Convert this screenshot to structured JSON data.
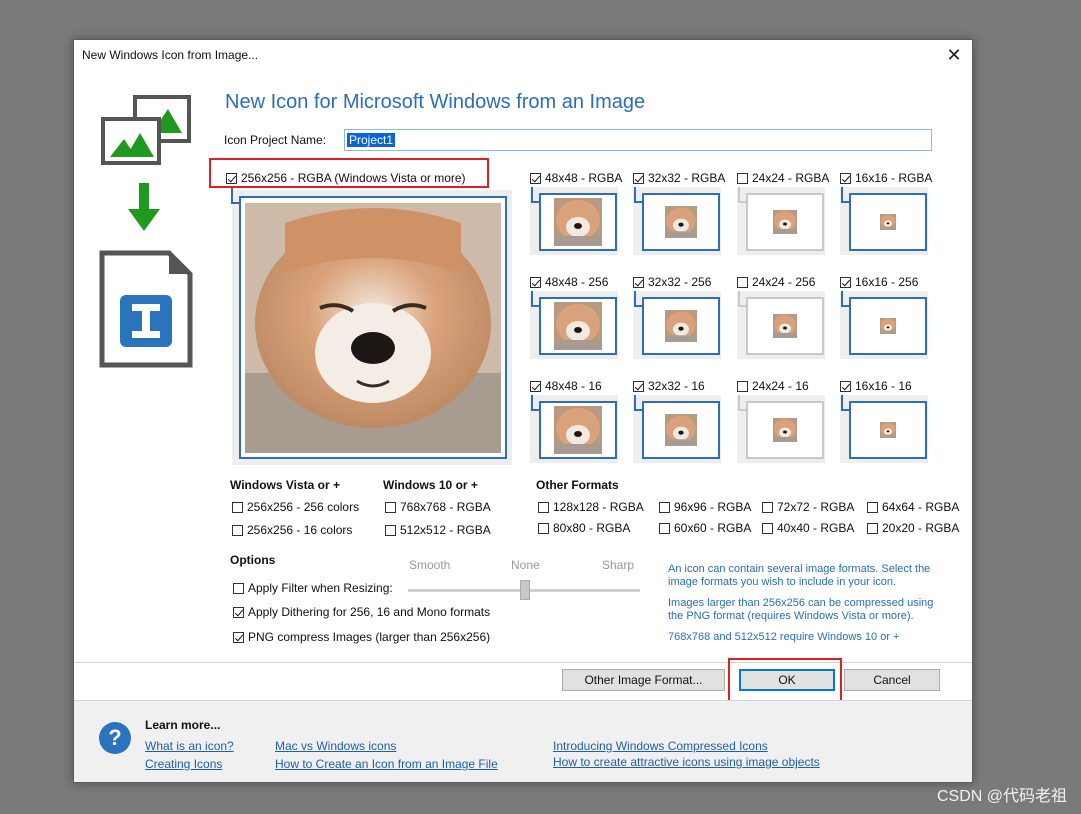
{
  "window": {
    "title": "New Windows Icon from Image...",
    "close_glyph": "✕"
  },
  "heading": "New Icon for Microsoft Windows from an Image",
  "project": {
    "label": "Icon Project Name:",
    "value": "Project1"
  },
  "main_format": {
    "label": "256x256 - RGBA (Windows Vista or more)",
    "checked": true
  },
  "formats": [
    {
      "label": "48x48 - RGBA",
      "checked": true
    },
    {
      "label": "32x32 - RGBA",
      "checked": true
    },
    {
      "label": "24x24 - RGBA",
      "checked": false
    },
    {
      "label": "16x16 - RGBA",
      "checked": true
    },
    {
      "label": "48x48 - 256",
      "checked": true
    },
    {
      "label": "32x32 - 256",
      "checked": true
    },
    {
      "label": "24x24 - 256",
      "checked": false
    },
    {
      "label": "16x16 - 256",
      "checked": true
    },
    {
      "label": "48x48 - 16",
      "checked": true
    },
    {
      "label": "32x32 - 16",
      "checked": true
    },
    {
      "label": "24x24 - 16",
      "checked": false
    },
    {
      "label": "16x16 - 16",
      "checked": true
    }
  ],
  "sections": {
    "vista": {
      "title": "Windows Vista or +",
      "items": [
        {
          "label": "256x256 - 256 colors",
          "checked": false
        },
        {
          "label": "256x256 - 16 colors",
          "checked": false
        }
      ]
    },
    "win10": {
      "title": "Windows 10 or +",
      "items": [
        {
          "label": "768x768 - RGBA",
          "checked": false
        },
        {
          "label": "512x512 - RGBA",
          "checked": false
        }
      ]
    },
    "other": {
      "title": "Other Formats",
      "items": [
        {
          "label": "128x128 - RGBA",
          "checked": false
        },
        {
          "label": "96x96 - RGBA",
          "checked": false
        },
        {
          "label": "72x72 - RGBA",
          "checked": false
        },
        {
          "label": "64x64 - RGBA",
          "checked": false
        },
        {
          "label": "80x80 - RGBA",
          "checked": false
        },
        {
          "label": "60x60 - RGBA",
          "checked": false
        },
        {
          "label": "40x40 - RGBA",
          "checked": false
        },
        {
          "label": "20x20 - RGBA",
          "checked": false
        }
      ]
    }
  },
  "options": {
    "title": "Options",
    "filter": {
      "label": "Apply Filter when Resizing:",
      "checked": false
    },
    "dithering": {
      "label": "Apply Dithering for 256, 16 and Mono formats",
      "checked": true
    },
    "png": {
      "label": "PNG compress Images (larger than 256x256)",
      "checked": true
    },
    "slider": {
      "labels": [
        "Smooth",
        "None",
        "Sharp"
      ],
      "value": "None"
    }
  },
  "info": {
    "p1": [
      "An icon can contain several image formats. Select the",
      "image formats you wish to include in your icon."
    ],
    "p2": [
      "Images larger than 256x256 can be compressed using",
      "the PNG format (requires Windows Vista or more)."
    ],
    "p3": "768x768 and 512x512 require Windows 10 or +"
  },
  "buttons": {
    "other": "Other Image Format...",
    "ok": "OK",
    "cancel": "Cancel"
  },
  "footer": {
    "learn_more": "Learn more...",
    "links": [
      "What is an icon?",
      "Creating Icons",
      "Mac vs Windows icons",
      "How to Create an Icon from an Image File",
      "Introducing Windows Compressed Icons",
      "How to create attractive icons using image objects"
    ]
  },
  "icons": {
    "help": "question-icon",
    "arrow": "arrow-down-icon",
    "images": "images-icon",
    "document": "icon-file-icon"
  },
  "colors": {
    "accent": "#2a6ebb",
    "highlight": "#e02020",
    "green": "#1f9a1f"
  },
  "watermark": "CSDN @代码老祖"
}
